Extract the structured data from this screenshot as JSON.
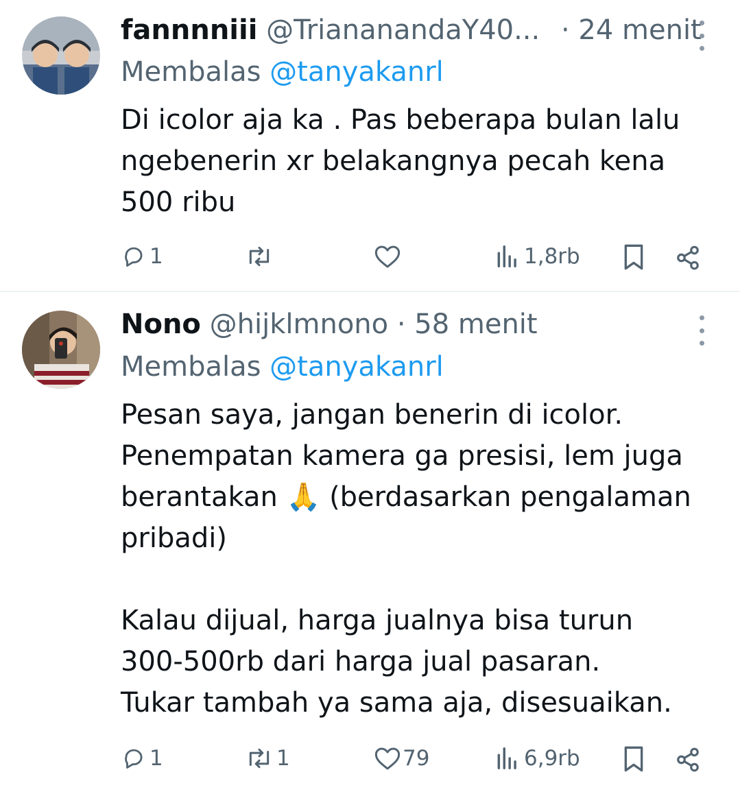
{
  "tweets": [
    {
      "display_name": "fannnniii",
      "handle": "@TriananandaY40...",
      "time": "· 24 menit",
      "reply_prefix": "Membalas",
      "reply_to": "@tanyakanrl",
      "text": "Di icolor aja ka . Pas beberapa bulan lalu\nngebenerin xr belakangnya pecah kena\n500 ribu",
      "actions": {
        "replies": "1",
        "retweets": "",
        "likes": "",
        "views": "1,8rb"
      }
    },
    {
      "display_name": "Nono",
      "handle": "@hijklmnono",
      "time": "· 58 menit",
      "reply_prefix": "Membalas",
      "reply_to": "@tanyakanrl",
      "text": "Pesan saya, jangan benerin di icolor.\nPenempatan kamera ga presisi, lem juga\nberantakan 🙏 (berdasarkan pengalaman\npribadi)\n\nKalau dijual, harga jualnya bisa turun\n300-500rb dari harga jual pasaran.\nTukar tambah ya sama aja, disesuaikan.",
      "actions": {
        "replies": "1",
        "retweets": "1",
        "likes": "79",
        "views": "6,9rb"
      }
    }
  ],
  "colors": {
    "text": "#0f1419",
    "secondary": "#536471",
    "link": "#1d9bf0",
    "divider": "#eff3f4"
  },
  "icons": [
    "reply-icon",
    "retweet-icon",
    "like-icon",
    "views-icon",
    "bookmark-icon",
    "share-icon",
    "more-icon"
  ]
}
